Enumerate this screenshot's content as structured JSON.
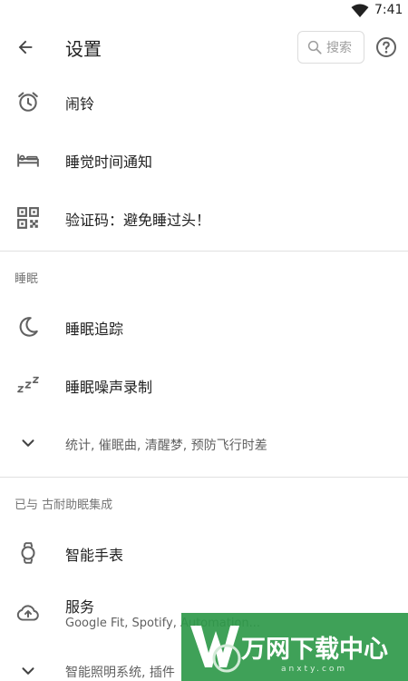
{
  "status_bar": {
    "time": "7:41"
  },
  "header": {
    "title": "设置",
    "search_label": "搜索"
  },
  "top_items": [
    {
      "label": "闹铃",
      "icon": "alarm-clock-icon"
    },
    {
      "label": "睡觉时间通知",
      "icon": "bed-icon"
    },
    {
      "label": "验证码：避免睡过头！",
      "icon": "qr-code-icon"
    }
  ],
  "sleep_section": {
    "header": "睡眠",
    "items": [
      {
        "label": "睡眠追踪",
        "icon": "moon-icon"
      },
      {
        "label": "睡眠噪声录制",
        "icon": "zzz-icon"
      }
    ],
    "more": "统计, 催眠曲, 清醒梦, 预防飞行时差"
  },
  "integration_section": {
    "header": "已与 古耐助眠集成",
    "items": [
      {
        "label": "智能手表",
        "icon": "watch-icon"
      },
      {
        "label": "服务",
        "sub": "Google Fit, Spotify, Automation...",
        "icon": "cloud-upload-icon"
      }
    ],
    "more": "智能照明系统, 插件"
  },
  "watermark": {
    "text": "万网下载中心",
    "sub": "anxty.com"
  },
  "colors": {
    "icon": "#616161",
    "divider": "#e0e0e0",
    "watermark_bg": "#2f9a4a"
  }
}
